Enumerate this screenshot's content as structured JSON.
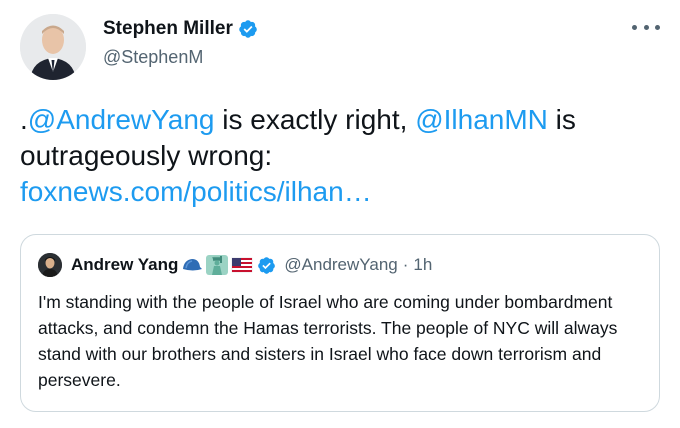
{
  "tweet": {
    "author_name": "Stephen Miller",
    "author_handle": "@StephenM",
    "text_prefix": ".",
    "mention1": "@AndrewYang",
    "text_mid": " is exactly right, ",
    "mention2": "@IlhanMN",
    "text_suffix": " is outrageously wrong:",
    "link": "foxnews.com/politics/ilhan…"
  },
  "quoted": {
    "author_name": "Andrew Yang",
    "emojis": [
      "blue-cap-emoji",
      "statue-of-liberty-emoji",
      "us-flag-emoji"
    ],
    "author_handle": "@AndrewYang",
    "separator": "·",
    "time": "1h",
    "text": "I'm standing with the people of Israel who are coming under bombardment attacks, and condemn the Hamas terrorists. The people of NYC will always stand with our brothers and sisters in Israel who face down terrorism and persevere."
  },
  "colors": {
    "link": "#1d9bf0",
    "verified": "#1d9bf0",
    "secondary_text": "#536471",
    "border": "#cfd9de"
  },
  "icons": [
    "verified-badge-icon",
    "more-options-icon"
  ]
}
